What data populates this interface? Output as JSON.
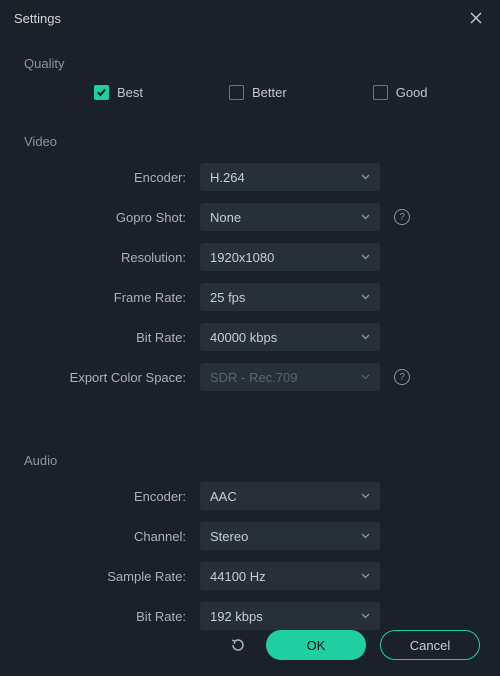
{
  "window": {
    "title": "Settings"
  },
  "quality": {
    "label": "Quality",
    "options": [
      {
        "label": "Best",
        "checked": true
      },
      {
        "label": "Better",
        "checked": false
      },
      {
        "label": "Good",
        "checked": false
      }
    ]
  },
  "video": {
    "label": "Video",
    "fields": {
      "encoder": {
        "label": "Encoder:",
        "value": "H.264"
      },
      "gopro": {
        "label": "Gopro Shot:",
        "value": "None",
        "help": true
      },
      "resolution": {
        "label": "Resolution:",
        "value": "1920x1080"
      },
      "framerate": {
        "label": "Frame Rate:",
        "value": "25 fps"
      },
      "bitrate": {
        "label": "Bit Rate:",
        "value": "40000 kbps"
      },
      "colorspace": {
        "label": "Export Color Space:",
        "value": "SDR - Rec.709",
        "disabled": true,
        "help": true
      }
    }
  },
  "audio": {
    "label": "Audio",
    "fields": {
      "encoder": {
        "label": "Encoder:",
        "value": "AAC"
      },
      "channel": {
        "label": "Channel:",
        "value": "Stereo"
      },
      "samplerate": {
        "label": "Sample Rate:",
        "value": "44100 Hz"
      },
      "bitrate": {
        "label": "Bit Rate:",
        "value": "192 kbps"
      }
    }
  },
  "footer": {
    "ok": "OK",
    "cancel": "Cancel"
  },
  "colors": {
    "accent": "#1fcfa1",
    "bg": "#1a2129",
    "field": "#272f38"
  }
}
